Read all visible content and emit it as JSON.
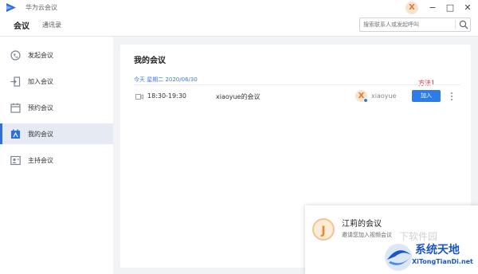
{
  "app": {
    "title": "华为云会议",
    "avatar_letter": "X"
  },
  "window_controls": {
    "minimize": "−",
    "maximize": "□",
    "close": "✕"
  },
  "nav": {
    "tab_meetings": "会议",
    "tab_contacts": "通讯录",
    "search_placeholder": "搜索联系人或发起呼叫"
  },
  "sidebar": {
    "items": [
      {
        "label": "发起会议",
        "icon": "video-call-icon"
      },
      {
        "label": "加入会议",
        "icon": "join-icon"
      },
      {
        "label": "预约会议",
        "icon": "calendar-icon"
      },
      {
        "label": "我的会议",
        "icon": "my-meetings-icon",
        "active": true
      },
      {
        "label": "主持会议",
        "icon": "host-icon"
      }
    ]
  },
  "main": {
    "title": "我的会议",
    "date_line": "今天 星期二 2020/06/30",
    "meeting": {
      "time": "18:30-19:30",
      "subject": "xiaoyue的会议",
      "host_avatar": "X",
      "host_name": "xiaoyue",
      "join_label": "加入"
    },
    "annotation": "方法1"
  },
  "toast": {
    "avatar_letter": "J",
    "title": "江莉的会议",
    "subtitle": "邀请您加入视频会议"
  },
  "watermark": {
    "overlay_text": "下软件园",
    "title": "系统天地",
    "url": "XiTongTianDi.net"
  },
  "colors": {
    "accent": "#2f7be8",
    "active_bg": "#e6ebf3",
    "annotation": "#e0202e",
    "watermark": "#1a56c4"
  }
}
